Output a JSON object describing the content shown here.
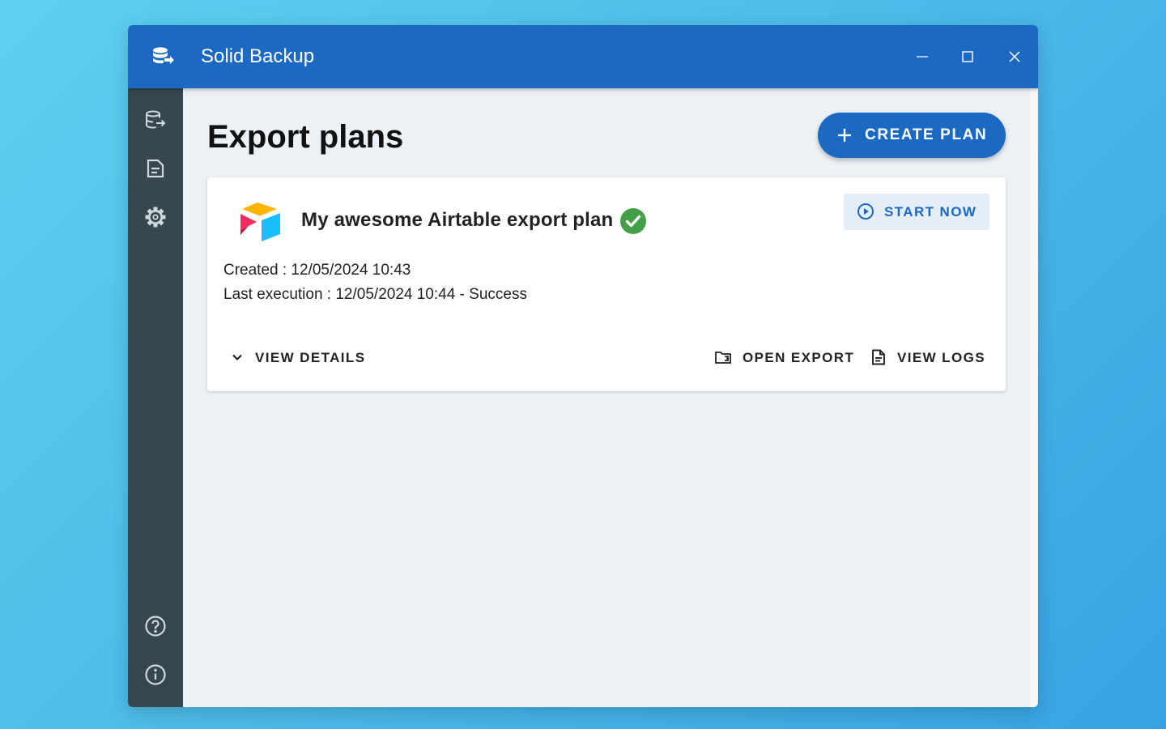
{
  "window": {
    "title": "Solid Backup",
    "app_icon": "database-export-icon",
    "controls": {
      "minimize_icon": "minimize-icon",
      "maximize_icon": "maximize-icon",
      "close_icon": "close-icon"
    }
  },
  "sidebar": {
    "items": [
      {
        "name": "export-plans",
        "icon": "database-export-icon"
      },
      {
        "name": "logs",
        "icon": "document-icon"
      },
      {
        "name": "settings",
        "icon": "gear-icon"
      },
      {
        "name": "help",
        "icon": "help-circle-icon"
      },
      {
        "name": "about",
        "icon": "info-circle-icon"
      }
    ]
  },
  "main": {
    "title": "Export plans",
    "create_button": {
      "label": "CREATE PLAN",
      "icon": "plus-icon"
    }
  },
  "plans": [
    {
      "name": "My awesome Airtable export plan",
      "source_icon": "airtable-logo",
      "status_icon": "check-circle-icon",
      "created": "Created : 12/05/2024 10:43",
      "last_execution": "Last execution : 12/05/2024 10:44 - Success",
      "start_label": "START NOW",
      "view_details_label": "VIEW DETAILS",
      "open_export_label": "OPEN EXPORT",
      "view_logs_label": "VIEW LOGS"
    }
  ],
  "colors": {
    "primary": "#1b69c2",
    "sidebar": "#37474f",
    "content_background": "#ecf1f5",
    "success": "#43a047",
    "start_button_background": "#e5edf7"
  }
}
